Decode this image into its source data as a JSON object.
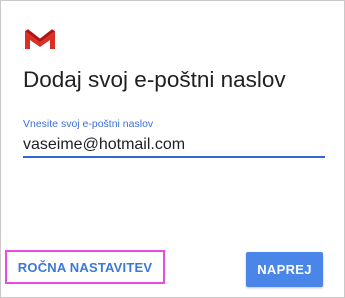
{
  "app": {
    "logo_icon": "gmail-logo-icon",
    "brand_colors": {
      "logo_red": "#d93025",
      "logo_dark_red": "#b31412",
      "accent_blue": "#4a86e8",
      "label_blue": "#3d6fdd",
      "highlight_pink": "#e84be0"
    }
  },
  "page": {
    "title": "Dodaj svoj e-poštni naslov"
  },
  "email": {
    "label": "Vnesite svoj e-poštni naslov",
    "value": "vaseime@hotmail.com"
  },
  "actions": {
    "manual_setup_label": "ROČNA NASTAVITEV",
    "next_label": "NAPREJ"
  }
}
